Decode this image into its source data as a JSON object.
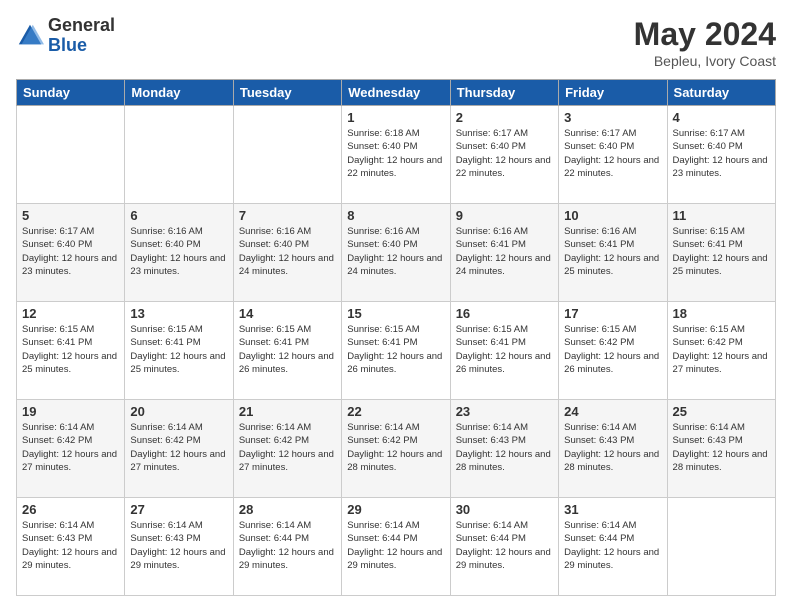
{
  "logo": {
    "general": "General",
    "blue": "Blue"
  },
  "title": "May 2024",
  "location": "Bepleu, Ivory Coast",
  "days_of_week": [
    "Sunday",
    "Monday",
    "Tuesday",
    "Wednesday",
    "Thursday",
    "Friday",
    "Saturday"
  ],
  "weeks": [
    [
      {
        "day": "",
        "info": ""
      },
      {
        "day": "",
        "info": ""
      },
      {
        "day": "",
        "info": ""
      },
      {
        "day": "1",
        "info": "Sunrise: 6:18 AM\nSunset: 6:40 PM\nDaylight: 12 hours and 22 minutes."
      },
      {
        "day": "2",
        "info": "Sunrise: 6:17 AM\nSunset: 6:40 PM\nDaylight: 12 hours and 22 minutes."
      },
      {
        "day": "3",
        "info": "Sunrise: 6:17 AM\nSunset: 6:40 PM\nDaylight: 12 hours and 22 minutes."
      },
      {
        "day": "4",
        "info": "Sunrise: 6:17 AM\nSunset: 6:40 PM\nDaylight: 12 hours and 23 minutes."
      }
    ],
    [
      {
        "day": "5",
        "info": "Sunrise: 6:17 AM\nSunset: 6:40 PM\nDaylight: 12 hours and 23 minutes."
      },
      {
        "day": "6",
        "info": "Sunrise: 6:16 AM\nSunset: 6:40 PM\nDaylight: 12 hours and 23 minutes."
      },
      {
        "day": "7",
        "info": "Sunrise: 6:16 AM\nSunset: 6:40 PM\nDaylight: 12 hours and 24 minutes."
      },
      {
        "day": "8",
        "info": "Sunrise: 6:16 AM\nSunset: 6:40 PM\nDaylight: 12 hours and 24 minutes."
      },
      {
        "day": "9",
        "info": "Sunrise: 6:16 AM\nSunset: 6:41 PM\nDaylight: 12 hours and 24 minutes."
      },
      {
        "day": "10",
        "info": "Sunrise: 6:16 AM\nSunset: 6:41 PM\nDaylight: 12 hours and 25 minutes."
      },
      {
        "day": "11",
        "info": "Sunrise: 6:15 AM\nSunset: 6:41 PM\nDaylight: 12 hours and 25 minutes."
      }
    ],
    [
      {
        "day": "12",
        "info": "Sunrise: 6:15 AM\nSunset: 6:41 PM\nDaylight: 12 hours and 25 minutes."
      },
      {
        "day": "13",
        "info": "Sunrise: 6:15 AM\nSunset: 6:41 PM\nDaylight: 12 hours and 25 minutes."
      },
      {
        "day": "14",
        "info": "Sunrise: 6:15 AM\nSunset: 6:41 PM\nDaylight: 12 hours and 26 minutes."
      },
      {
        "day": "15",
        "info": "Sunrise: 6:15 AM\nSunset: 6:41 PM\nDaylight: 12 hours and 26 minutes."
      },
      {
        "day": "16",
        "info": "Sunrise: 6:15 AM\nSunset: 6:41 PM\nDaylight: 12 hours and 26 minutes."
      },
      {
        "day": "17",
        "info": "Sunrise: 6:15 AM\nSunset: 6:42 PM\nDaylight: 12 hours and 26 minutes."
      },
      {
        "day": "18",
        "info": "Sunrise: 6:15 AM\nSunset: 6:42 PM\nDaylight: 12 hours and 27 minutes."
      }
    ],
    [
      {
        "day": "19",
        "info": "Sunrise: 6:14 AM\nSunset: 6:42 PM\nDaylight: 12 hours and 27 minutes."
      },
      {
        "day": "20",
        "info": "Sunrise: 6:14 AM\nSunset: 6:42 PM\nDaylight: 12 hours and 27 minutes."
      },
      {
        "day": "21",
        "info": "Sunrise: 6:14 AM\nSunset: 6:42 PM\nDaylight: 12 hours and 27 minutes."
      },
      {
        "day": "22",
        "info": "Sunrise: 6:14 AM\nSunset: 6:42 PM\nDaylight: 12 hours and 28 minutes."
      },
      {
        "day": "23",
        "info": "Sunrise: 6:14 AM\nSunset: 6:43 PM\nDaylight: 12 hours and 28 minutes."
      },
      {
        "day": "24",
        "info": "Sunrise: 6:14 AM\nSunset: 6:43 PM\nDaylight: 12 hours and 28 minutes."
      },
      {
        "day": "25",
        "info": "Sunrise: 6:14 AM\nSunset: 6:43 PM\nDaylight: 12 hours and 28 minutes."
      }
    ],
    [
      {
        "day": "26",
        "info": "Sunrise: 6:14 AM\nSunset: 6:43 PM\nDaylight: 12 hours and 29 minutes."
      },
      {
        "day": "27",
        "info": "Sunrise: 6:14 AM\nSunset: 6:43 PM\nDaylight: 12 hours and 29 minutes."
      },
      {
        "day": "28",
        "info": "Sunrise: 6:14 AM\nSunset: 6:44 PM\nDaylight: 12 hours and 29 minutes."
      },
      {
        "day": "29",
        "info": "Sunrise: 6:14 AM\nSunset: 6:44 PM\nDaylight: 12 hours and 29 minutes."
      },
      {
        "day": "30",
        "info": "Sunrise: 6:14 AM\nSunset: 6:44 PM\nDaylight: 12 hours and 29 minutes."
      },
      {
        "day": "31",
        "info": "Sunrise: 6:14 AM\nSunset: 6:44 PM\nDaylight: 12 hours and 29 minutes."
      },
      {
        "day": "",
        "info": ""
      }
    ]
  ]
}
